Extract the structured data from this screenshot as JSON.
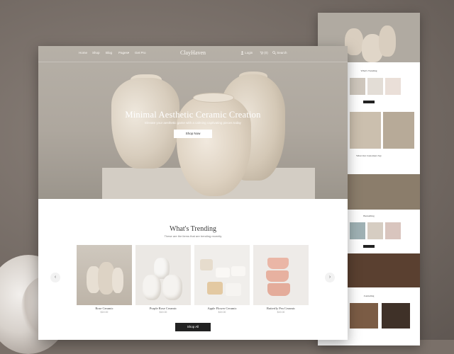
{
  "nav": {
    "links": [
      "Home",
      "Shop",
      "Blog",
      "Pages",
      "Get Pro"
    ],
    "pages_chevron": "▾",
    "logo": "ClayHaven",
    "right": {
      "login": "Login",
      "cart": "(0)",
      "search": "Search"
    }
  },
  "hero": {
    "title": "Minimal Aesthetic Ceramic Creation",
    "subtitle": "Elevate your aesthetic game with a calming captivating pieces today",
    "button": "Shop Now"
  },
  "trending": {
    "title": "What's Trending",
    "subtitle": "These are the items that are trending recently",
    "prev_arrow": "‹",
    "next_arrow": "›",
    "products": [
      {
        "name": "Rose Ceramic",
        "price": "$19.00"
      },
      {
        "name": "Purple Rose Ceramic",
        "price": "$19.00"
      },
      {
        "name": "Apple Flower Ceramic",
        "price": "$19.00"
      },
      {
        "name": "Butterfly Pea Ceramic",
        "price": "$19.00"
      }
    ],
    "shop_all": "Shop All"
  },
  "long_page": {
    "sections": [
      "What's Trending",
      "What Our Customers Say",
      "Bestselling",
      "Learn Pottery With Us",
      "Journaling"
    ]
  },
  "colors": {
    "hero_bg": "#aea79e",
    "button_dark": "#222222",
    "backdrop": "#7a7069"
  }
}
